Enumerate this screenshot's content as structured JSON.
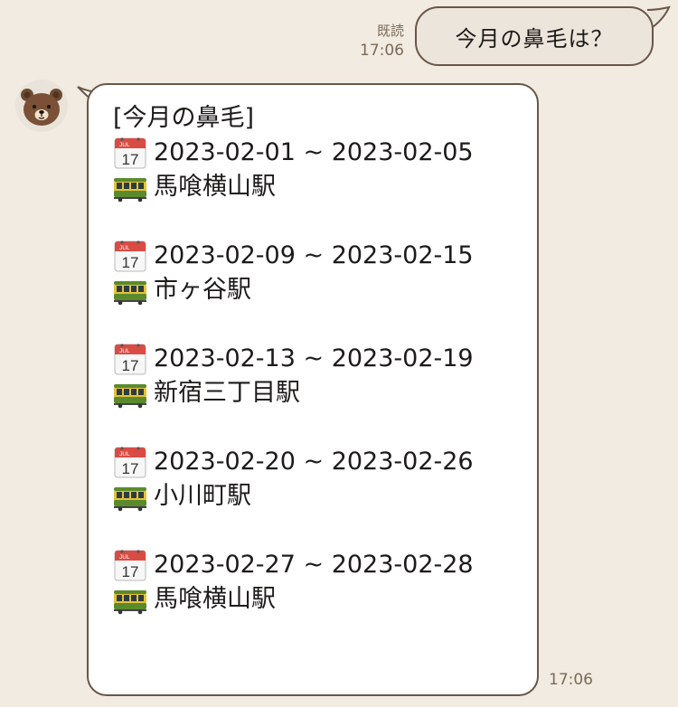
{
  "outgoing": {
    "text": "今月の鼻毛は？",
    "read_label": "既読",
    "time": "17:06"
  },
  "incoming": {
    "avatar_icon": "brown-bear-icon",
    "title": "[今月の鼻毛]",
    "time": "17:06",
    "entries": [
      {
        "date_range": "2023-02-01 ~ 2023-02-05",
        "station": "馬喰横山駅"
      },
      {
        "date_range": "2023-02-09 ~ 2023-02-15",
        "station": "市ヶ谷駅"
      },
      {
        "date_range": "2023-02-13 ~ 2023-02-19",
        "station": "新宿三丁目駅"
      },
      {
        "date_range": "2023-02-20 ~ 2023-02-26",
        "station": "小川町駅"
      },
      {
        "date_range": "2023-02-27 ~ 2023-02-28",
        "station": "馬喰横山駅"
      }
    ],
    "calendar_icon": {
      "month": "JUL",
      "day": "17"
    },
    "train_icon": "tram-car-icon"
  },
  "colors": {
    "background": "#f1ebe2",
    "bubble_border": "#6a5646",
    "meta_text": "#7c6a55"
  }
}
